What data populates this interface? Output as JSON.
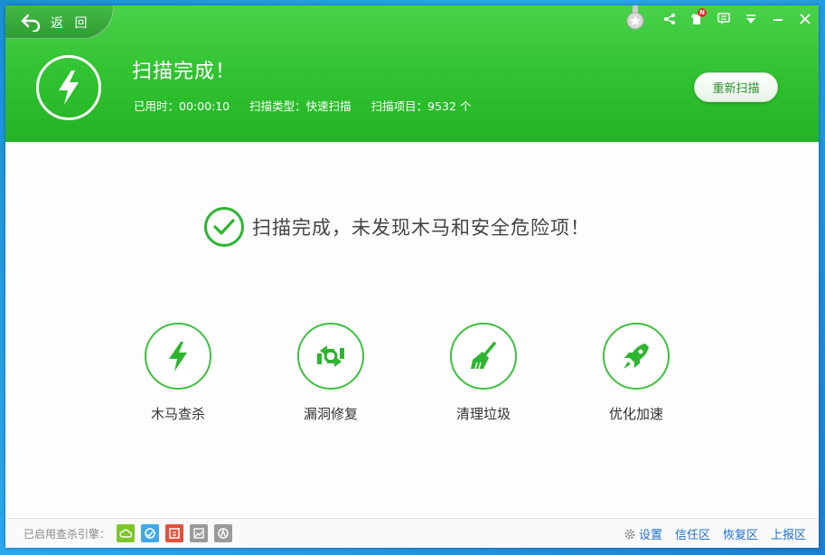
{
  "header": {
    "back_label": "返 回",
    "title": "扫描完成！",
    "info": {
      "elapsed": "已用时：00:00:10",
      "scan_type": "扫描类型：快速扫描",
      "scan_items": "扫描项目：9532 个"
    },
    "rescan_label": "重新扫描",
    "notification_badge": "N",
    "icons": [
      "medal-icon",
      "share-icon",
      "shirt-icon",
      "chat-icon",
      "menu-icon",
      "minimize-icon",
      "close-icon"
    ]
  },
  "result": {
    "message": "扫描完成，未发现木马和安全危险项！"
  },
  "tools": [
    {
      "label": "木马查杀",
      "icon": "bolt-icon"
    },
    {
      "label": "漏洞修复",
      "icon": "repair-icon"
    },
    {
      "label": "清理垃圾",
      "icon": "broom-icon"
    },
    {
      "label": "优化加速",
      "icon": "rocket-icon"
    }
  ],
  "footer": {
    "engines_label": "已启用查杀引擎：",
    "engines": [
      {
        "name": "cloud-engine-icon",
        "color": "#7dc62a"
      },
      {
        "name": "qvm-engine-icon",
        "color": "#3fa9e6"
      },
      {
        "name": "qex-engine-icon",
        "color": "#e5503c"
      },
      {
        "name": "image-engine-icon",
        "color": "#9a9a9a"
      },
      {
        "name": "avira-engine-icon",
        "color": "#9a9a9a"
      }
    ],
    "settings_label": "设置",
    "trust_label": "信任区",
    "restore_label": "恢复区",
    "report_label": "上报区"
  },
  "colors": {
    "accent": "#2fc12f",
    "link": "#1e6fcf"
  }
}
